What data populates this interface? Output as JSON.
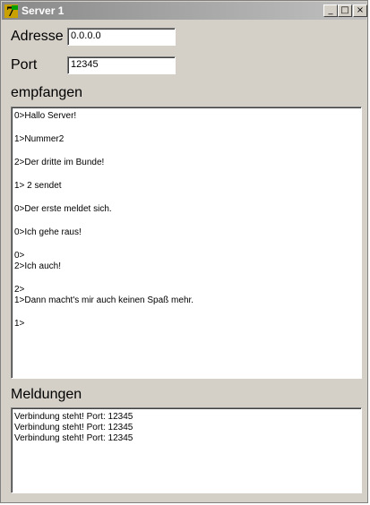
{
  "window": {
    "title": "Server 1",
    "controls": {
      "minimize": "_",
      "maximize": "□",
      "close": "×"
    }
  },
  "form": {
    "address_label": "Adresse",
    "address_value": "0.0.0.0",
    "port_label": "Port",
    "port_value": "12345"
  },
  "received": {
    "label": "empfangen",
    "lines": [
      "0>Hallo Server!",
      "1>Nummer2",
      "2>Der dritte im Bunde!",
      "1> 2 sendet",
      "0>Der erste meldet sich.",
      "0>Ich gehe raus!",
      "0>",
      "2>Ich auch!",
      "2>",
      "1>Dann macht's mir auch keinen Spaß mehr.",
      "1>"
    ]
  },
  "messages": {
    "label": "Meldungen",
    "lines": [
      "Verbindung steht! Port: 12345",
      "Verbindung steht! Port: 12345",
      "Verbindung steht! Port: 12345"
    ]
  }
}
